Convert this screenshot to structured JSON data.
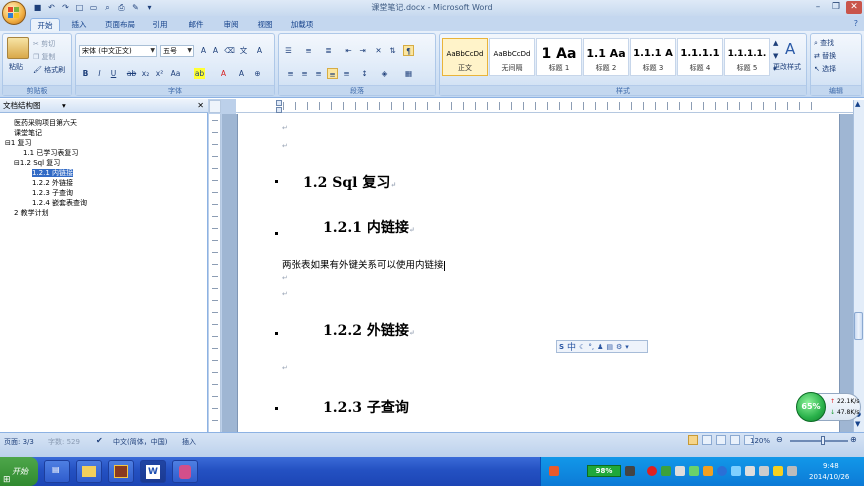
{
  "window": {
    "title": "课堂笔记.docx - Microsoft Word"
  },
  "tabs": [
    "开始",
    "插入",
    "页面布局",
    "引用",
    "邮件",
    "审阅",
    "视图",
    "加载项"
  ],
  "ribbon": {
    "clipboard": {
      "paste": "粘贴",
      "cut": "剪切",
      "copy": "复制",
      "format_painter": "格式刷",
      "label": "剪贴板"
    },
    "font": {
      "font_name": "宋体 (中文正文)",
      "font_size": "五号",
      "label": "字体"
    },
    "paragraph": {
      "label": "段落"
    },
    "styles": {
      "label": "样式",
      "items": [
        {
          "sample": "AaBbCcDd",
          "name": "正文"
        },
        {
          "sample": "AaBbCcDd",
          "name": "无间隔"
        },
        {
          "sample": "1 Aa",
          "name": "标题 1"
        },
        {
          "sample": "1.1 Aa",
          "name": "标题 2"
        },
        {
          "sample": "1.1.1 A",
          "name": "标题 3"
        },
        {
          "sample": "1.1.1.1",
          "name": "标题 4"
        },
        {
          "sample": "1.1.1.1.",
          "name": "标题 5"
        }
      ],
      "change_styles": "更改样式"
    },
    "editing": {
      "find": "查找",
      "replace": "替换",
      "select": "选择",
      "label": "编辑"
    }
  },
  "docmap": {
    "title": "文档结构图",
    "items": [
      {
        "text": "医药采购项目第六天",
        "indent": 0,
        "toggle": ""
      },
      {
        "text": "课堂笔记",
        "indent": 0,
        "toggle": ""
      },
      {
        "text": "1 复习",
        "indent": 0,
        "toggle": "⊟"
      },
      {
        "text": "1.1 已学习表复习",
        "indent": 1,
        "toggle": ""
      },
      {
        "text": "1.2 Sql 复习",
        "indent": 1,
        "toggle": "⊟"
      },
      {
        "text": "1.2.1 内链接",
        "indent": 2,
        "toggle": "",
        "selected": true
      },
      {
        "text": "1.2.2 外链接",
        "indent": 2,
        "toggle": ""
      },
      {
        "text": "1.2.3 子查询",
        "indent": 2,
        "toggle": ""
      },
      {
        "text": "1.2.4 嵌套表查询",
        "indent": 2,
        "toggle": ""
      },
      {
        "text": "2 教学计划",
        "indent": 0,
        "toggle": ""
      }
    ]
  },
  "document": {
    "h2": "1.2 Sql 复习",
    "h3_1": "1.2.1  内链接",
    "body_text": "两张表如果有外键关系可以使用内链接",
    "h3_2": "1.2.2  外链接",
    "h3_3": "1.2.3  子查询",
    "para_mark": "↵"
  },
  "ime": {
    "lang": "中"
  },
  "status": {
    "page": "页面: 3/3",
    "words": "字数: 529",
    "language": "中文(简体，中国)",
    "insert": "插入",
    "zoom": "120%"
  },
  "taskbar": {
    "start": "开始",
    "battery": "98%",
    "time": "9:48",
    "date": "2014/10/26"
  },
  "net": {
    "percent": "65%",
    "up": "22.1K/s",
    "down": "47.8K/s"
  },
  "colors": {
    "accent": "#15428b",
    "ribbon": "#cfe0f4",
    "taskbar": "#2451c2"
  }
}
